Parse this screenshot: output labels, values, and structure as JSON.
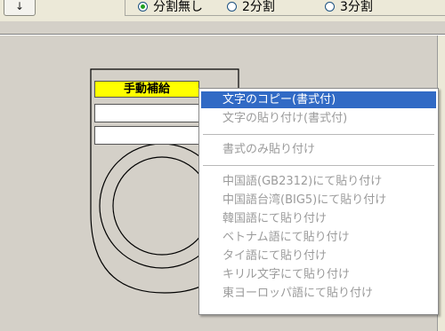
{
  "toolbar": {
    "down_arrow": "↓"
  },
  "split_options": {
    "items": [
      {
        "label": "分割無し",
        "selected": true
      },
      {
        "label": "2分割",
        "selected": false
      },
      {
        "label": "3分割",
        "selected": false
      }
    ]
  },
  "form": {
    "yellow_field_label": "手動補給"
  },
  "context_menu": {
    "items": [
      "文字のコピー(書式付)",
      "文字の貼り付け(書式付)",
      "書式のみ貼り付け",
      "中国語(GB2312)にて貼り付け",
      "中国語台湾(BIG5)にて貼り付け",
      "韓国語にて貼り付け",
      "ベトナム語にて貼り付け",
      "タイ語にて貼り付け",
      "キリル文字にて貼り付け",
      "東ヨーロッパ語にて貼り付け"
    ]
  }
}
